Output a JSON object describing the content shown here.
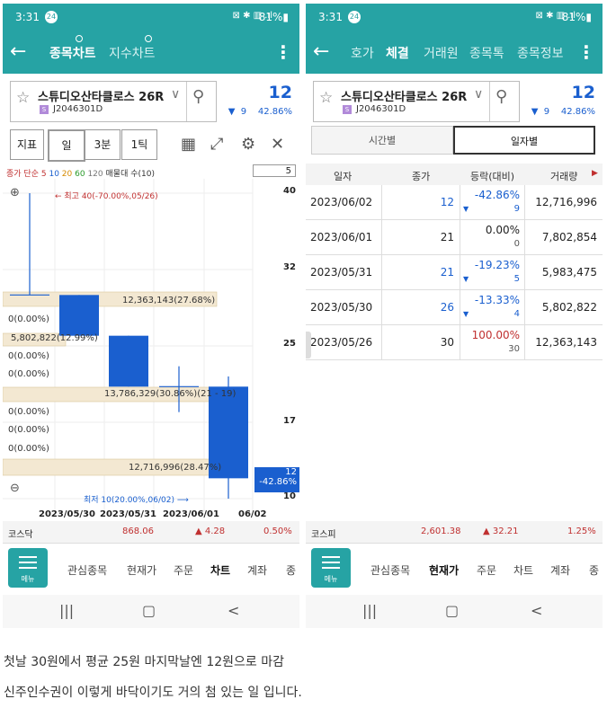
{
  "status_bar": {
    "time": "3:31",
    "badge": "24",
    "icons": "⊠ ✱ ▥ .ıl",
    "battery": "81%▮"
  },
  "left": {
    "tabs": [
      "종목차트",
      "지수차트"
    ],
    "stock": {
      "name": "스튜디오산타클로스 26R",
      "code": "J2046301D",
      "price": "12",
      "change": "9",
      "change_pct": "42.86%"
    },
    "toolbar": {
      "indicator": "지표",
      "period_day": "일",
      "period_3min": "3분",
      "period_1tick": "1틱"
    },
    "ma_legend": {
      "prefix": "종가 단순",
      "ma5": "5",
      "ma10": "10",
      "ma20": "20",
      "ma60": "60",
      "ma120": "120",
      "suffix": "매물대 수(10)"
    },
    "page_count": "5",
    "max_label": "← 최고 40(-70.00%,05/26)",
    "min_label": "최저 10(20.00%,06/02) ⟶",
    "price_tag": {
      "price": "12",
      "pct": "-42.86%"
    },
    "zero_labels": [
      "0(0.00%)",
      "0(0.00%)",
      "0(0.00%)",
      "0(0.00%)",
      "0(0.00%)",
      "0(0.00%)",
      "0(0.00%)"
    ],
    "volume_profile_labels": [
      "12,363,143(27.68%)",
      "5,802,822(12.99%)",
      "13,786,329(30.86%)(21 - 19)",
      "12,716,996(28.47%)"
    ],
    "index_bar": {
      "name": "코스닥",
      "value": "868.06",
      "change": "▲ 4.28",
      "pct": "0.50%"
    }
  },
  "chart_data": {
    "type": "candlestick",
    "categories": [
      "2023/05/26",
      "2023/05/30",
      "2023/05/31",
      "2023/06/01",
      "2023/06/02"
    ],
    "x_tick_labels": [
      "2023/05/30",
      "2023/05/31",
      "2023/06/01",
      "06/02"
    ],
    "ohlc": [
      {
        "date": "2023/05/26",
        "open": 30,
        "high": 40,
        "low": 30,
        "close": 30
      },
      {
        "date": "2023/05/30",
        "open": 30,
        "high": 30,
        "low": 26,
        "close": 26
      },
      {
        "date": "2023/05/31",
        "open": 26,
        "high": 26,
        "low": 21,
        "close": 21
      },
      {
        "date": "2023/06/01",
        "open": 21,
        "high": 23,
        "low": 18.5,
        "close": 21
      },
      {
        "date": "2023/06/02",
        "open": 21,
        "high": 22,
        "low": 10,
        "close": 12
      }
    ],
    "y_ticks": [
      40,
      32,
      25,
      17,
      10
    ],
    "ylim": [
      10,
      40
    ]
  },
  "right": {
    "tabs": [
      "호가",
      "체결",
      "거래원",
      "종목톡",
      "종목정보"
    ],
    "segments": [
      "시간별",
      "일자별"
    ],
    "columns": [
      "일자",
      "종가",
      "등락(대비)",
      "거래량"
    ],
    "rows": [
      {
        "date": "2023/06/02",
        "close": "12",
        "pct": "-42.86%",
        "diff": "9",
        "vol": "12,716,996"
      },
      {
        "date": "2023/06/01",
        "close": "21",
        "pct": "0.00%",
        "diff": "0",
        "vol": "7,802,854"
      },
      {
        "date": "2023/05/31",
        "close": "21",
        "pct": "-19.23%",
        "diff": "5",
        "vol": "5,983,475"
      },
      {
        "date": "2023/05/30",
        "close": "26",
        "pct": "-13.33%",
        "diff": "4",
        "vol": "5,802,822"
      },
      {
        "date": "2023/05/26",
        "close": "30",
        "pct": "100.00%",
        "diff": "30",
        "vol": "12,363,143"
      }
    ],
    "index_bar": {
      "name": "코스피",
      "value": "2,601.38",
      "change": "▲ 32.21",
      "pct": "1.25%"
    }
  },
  "bottom_nav": {
    "menu": "메뉴",
    "left_items": [
      "관심종목",
      "현재가",
      "주문",
      "차트",
      "계좌",
      "종"
    ],
    "right_items": [
      "관심종목",
      "현재가",
      "주문",
      "차트",
      "계좌",
      "종"
    ]
  },
  "sys_nav": {
    "recent": "|||",
    "home": "▢",
    "back": "<"
  },
  "captions": [
    "첫날 30원에서 평균 25원 마지막날엔 12원으로 마감",
    "신주인수권이 이렇게 바닥이기도 거의 첨 있는 일 입니다."
  ],
  "colors": {
    "accent": "#26a3a4",
    "up": "#c03030",
    "down": "#1a5fcf",
    "volume_band": "#f3e8d2"
  }
}
